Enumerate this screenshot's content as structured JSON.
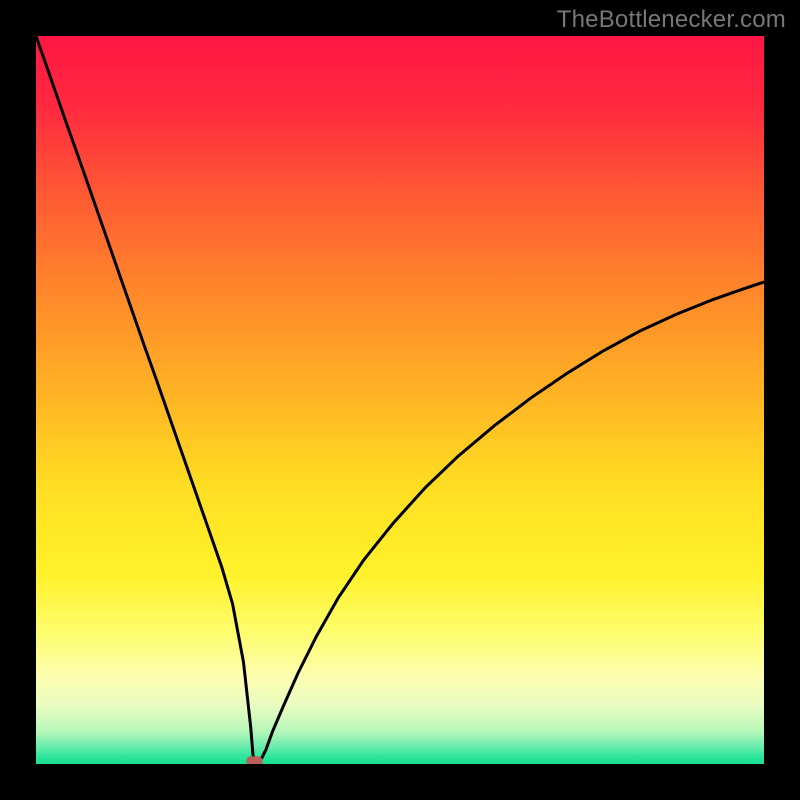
{
  "watermark": "TheBottlenecker.com",
  "colors": {
    "frame": "#000000",
    "curve": "#000000",
    "marker": "#b9605a"
  },
  "gradient_stops": [
    {
      "offset": 0.0,
      "color": "#ff1744"
    },
    {
      "offset": 0.1,
      "color": "#ff2a3f"
    },
    {
      "offset": 0.22,
      "color": "#ff5a33"
    },
    {
      "offset": 0.36,
      "color": "#ff8a2a"
    },
    {
      "offset": 0.5,
      "color": "#ffb624"
    },
    {
      "offset": 0.62,
      "color": "#ffde22"
    },
    {
      "offset": 0.74,
      "color": "#fff22a"
    },
    {
      "offset": 0.82,
      "color": "#fdfd6e"
    },
    {
      "offset": 0.88,
      "color": "#fdfdb0"
    },
    {
      "offset": 0.92,
      "color": "#e9fcc0"
    },
    {
      "offset": 0.955,
      "color": "#b6f7ba"
    },
    {
      "offset": 0.975,
      "color": "#6eedad"
    },
    {
      "offset": 0.99,
      "color": "#2de59b"
    },
    {
      "offset": 1.0,
      "color": "#18e28f"
    }
  ],
  "chart_data": {
    "type": "line",
    "title": "",
    "xlabel": "",
    "ylabel": "",
    "xlim": [
      0,
      100
    ],
    "ylim": [
      0,
      100
    ],
    "x": [
      0,
      1.5,
      3,
      4.5,
      6,
      7.5,
      9,
      10.5,
      12,
      13.5,
      15,
      16.5,
      18,
      19.5,
      21,
      22.5,
      24,
      25.5,
      27,
      28.5,
      29.5,
      29.8,
      30,
      30.2,
      30.5,
      31,
      31.6,
      32.5,
      34,
      36,
      38.5,
      41.5,
      45,
      49,
      53.5,
      58,
      63,
      68,
      73,
      78,
      83,
      88,
      93,
      97,
      100
    ],
    "y": [
      100,
      95.7,
      91.4,
      87.1,
      82.9,
      78.6,
      74.3,
      70.0,
      65.7,
      61.4,
      57.1,
      52.9,
      48.6,
      44.3,
      40.0,
      35.7,
      31.4,
      27.1,
      22.0,
      14.0,
      5.0,
      1.3,
      0.3,
      0.3,
      0.3,
      0.8,
      2.0,
      4.5,
      8.0,
      12.5,
      17.5,
      22.8,
      28.0,
      33.0,
      38.0,
      42.3,
      46.5,
      50.3,
      53.7,
      56.8,
      59.5,
      61.8,
      63.8,
      65.2,
      66.2
    ],
    "marker": {
      "x_pct": 30.0,
      "y_pct": 0.3
    },
    "annotations": []
  }
}
